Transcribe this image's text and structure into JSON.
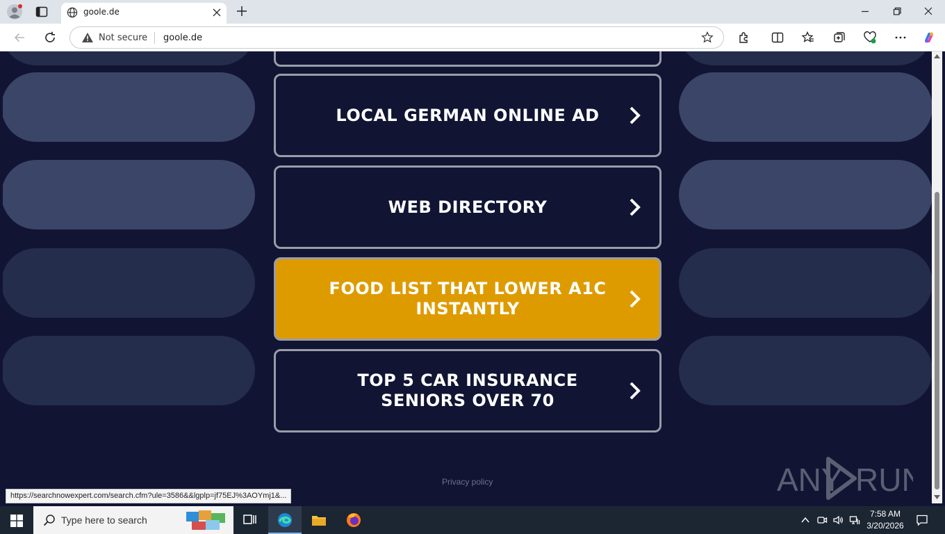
{
  "browser": {
    "tab_title": "goole.de",
    "security_label": "Not secure",
    "url": "goole.de"
  },
  "page": {
    "ads": [
      {
        "label": "LOCAL GERMAN ONLINE AD",
        "highlighted": false
      },
      {
        "label": "WEB DIRECTORY",
        "highlighted": false
      },
      {
        "label": "FOOD LIST THAT LOWER A1C INSTANTLY",
        "highlighted": true
      },
      {
        "label": "TOP 5 CAR INSURANCE SENIORS OVER 70",
        "highlighted": false
      }
    ],
    "privacy_link": "Privacy policy",
    "watermark_left": "ANY",
    "watermark_right": "RUN",
    "status_url": "https://searchnowexpert.com/search.cfm?ule=3586&&lgplp=jf75EJ%3AOYmj1&..."
  },
  "colors": {
    "page_bg": "#111533",
    "highlight": "#de9b00",
    "button_border": "#9a9ca8",
    "pill_light": "#3a4567",
    "pill_dark": "#252d4d"
  },
  "taskbar": {
    "search_placeholder": "Type here to search",
    "time": "7:58 AM",
    "date": "3/20/2026"
  }
}
